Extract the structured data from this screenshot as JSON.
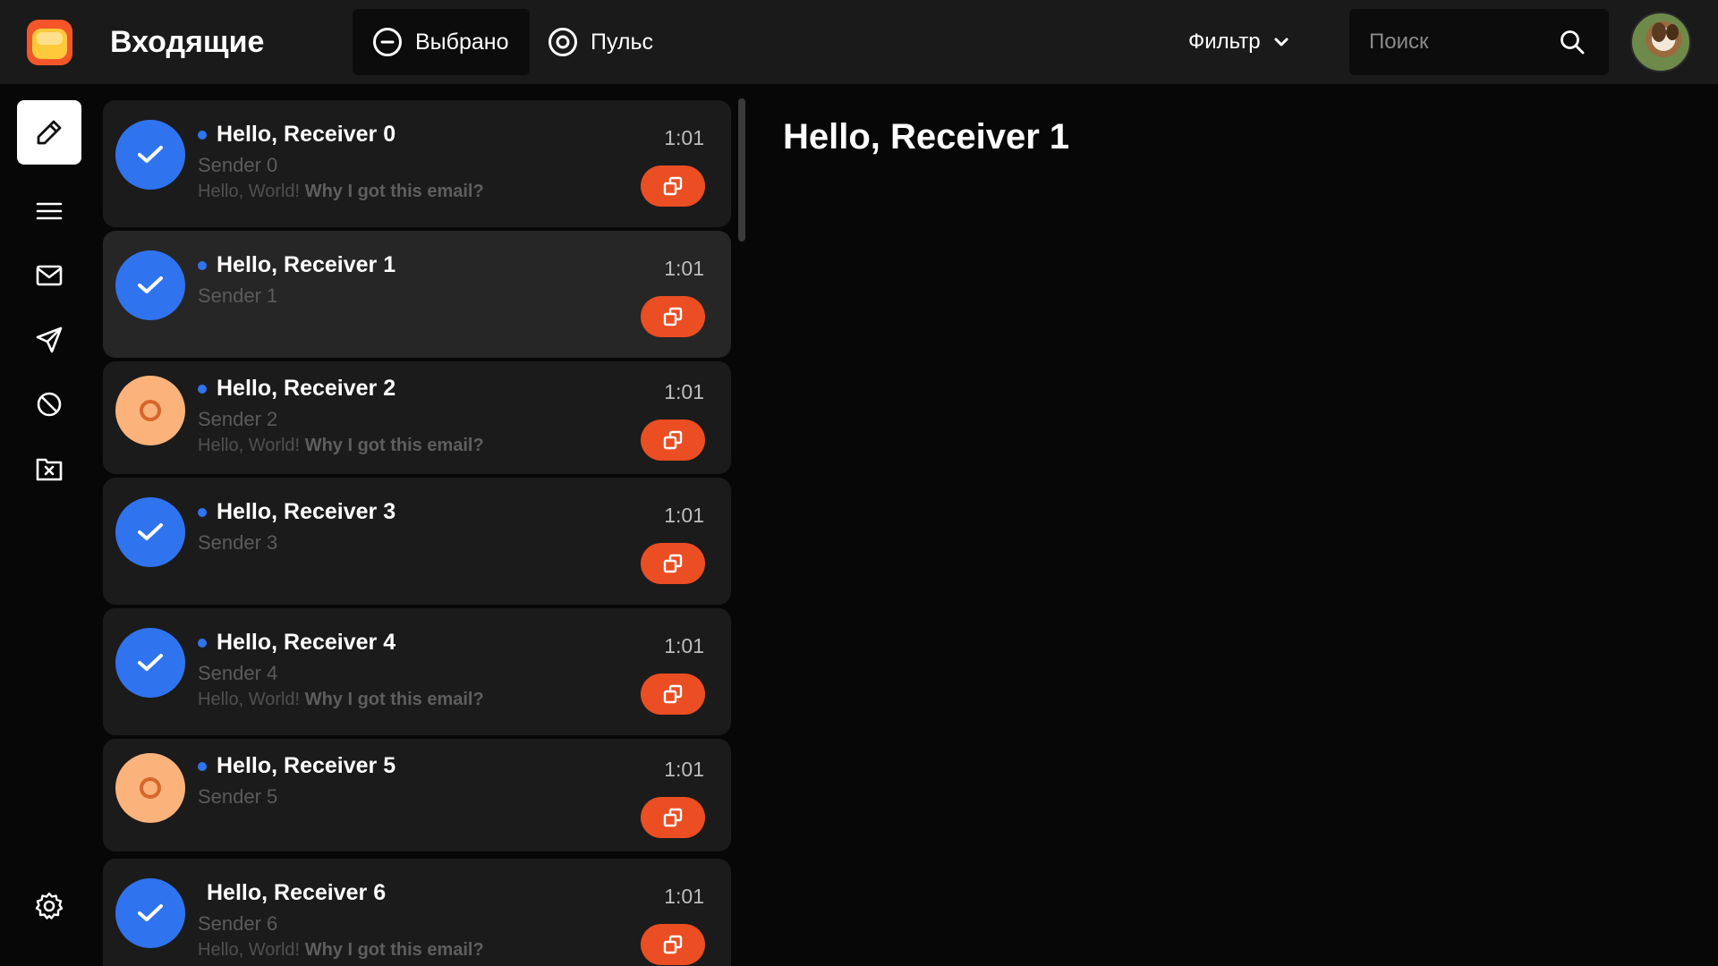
{
  "header": {
    "title": "Входящие",
    "tabs": [
      {
        "label": "Выбрано",
        "icon": "minus-circle-icon"
      },
      {
        "label": "Пульс",
        "icon": "target-circle-icon"
      }
    ],
    "filter_label": "Фильтр",
    "search_placeholder": "Поиск"
  },
  "sidebar": {
    "items": [
      {
        "name": "compose",
        "icon": "pencil-icon"
      },
      {
        "name": "menu",
        "icon": "menu-icon"
      },
      {
        "name": "inbox",
        "icon": "envelope-icon"
      },
      {
        "name": "sent",
        "icon": "send-icon"
      },
      {
        "name": "spam",
        "icon": "block-icon"
      },
      {
        "name": "trash",
        "icon": "folder-x-icon"
      },
      {
        "name": "settings",
        "icon": "gear-icon"
      }
    ]
  },
  "mails": [
    {
      "subject": "Hello, Receiver 0",
      "sender": "Sender 0",
      "preview_text": "Hello, World!",
      "preview_bold": "Why I got this email?",
      "time": "1:01",
      "status": "done",
      "unread": true
    },
    {
      "subject": "Hello, Receiver 1",
      "sender": "Sender 1",
      "preview_text": "",
      "preview_bold": "",
      "time": "1:01",
      "status": "done",
      "unread": true
    },
    {
      "subject": "Hello, Receiver 2",
      "sender": "Sender 2",
      "preview_text": "Hello, World!",
      "preview_bold": "Why I got this email?",
      "time": "1:01",
      "status": "pending",
      "unread": true
    },
    {
      "subject": "Hello, Receiver 3",
      "sender": "Sender 3",
      "preview_text": "",
      "preview_bold": "",
      "time": "1:01",
      "status": "done",
      "unread": true
    },
    {
      "subject": "Hello, Receiver 4",
      "sender": "Sender 4",
      "preview_text": "Hello, World!",
      "preview_bold": "Why I got this email?",
      "time": "1:01",
      "status": "done",
      "unread": true
    },
    {
      "subject": "Hello, Receiver 5",
      "sender": "Sender 5",
      "preview_text": "",
      "preview_bold": "",
      "time": "1:01",
      "status": "pending",
      "unread": true
    },
    {
      "subject": "Hello, Receiver 6",
      "sender": "Sender 6",
      "preview_text": "Hello, World!",
      "preview_bold": "Why I got this email?",
      "time": "1:01",
      "status": "done",
      "unread": false
    }
  ],
  "reader": {
    "title": "Hello, Receiver 1"
  },
  "colors": {
    "accent_blue": "#2f74ee",
    "accent_orange": "#ea4e22",
    "pending_peach": "#fcb37b"
  }
}
